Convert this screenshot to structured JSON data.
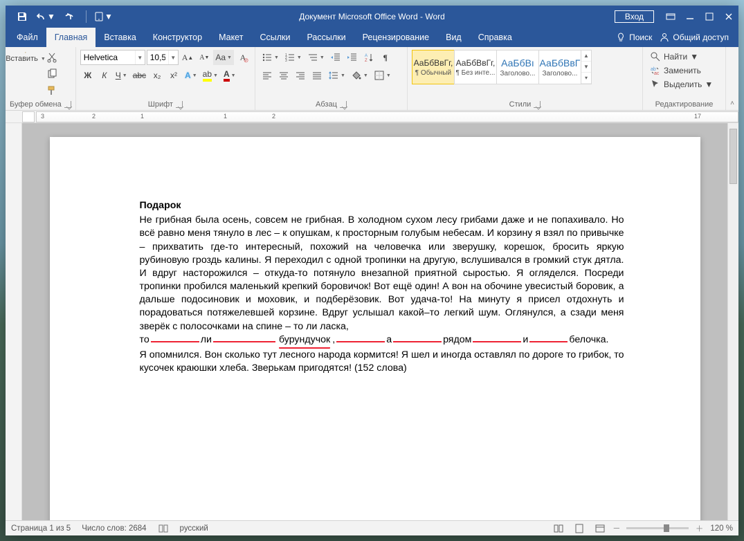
{
  "titlebar": {
    "title": "Документ Microsoft Office Word  -  Word",
    "login": "Вход"
  },
  "tabs": {
    "file": "Файл",
    "items": [
      "Главная",
      "Вставка",
      "Конструктор",
      "Макет",
      "Ссылки",
      "Рассылки",
      "Рецензирование",
      "Вид",
      "Справка"
    ],
    "active_index": 0,
    "tell_me": "Поиск",
    "share": "Общий доступ"
  },
  "ribbon": {
    "clipboard": {
      "paste": "Вставить",
      "label": "Буфер обмена"
    },
    "font": {
      "name": "Helvetica",
      "size": "10,5",
      "bold": "Ж",
      "italic": "К",
      "underline": "Ч",
      "strike": "abc",
      "sub": "x₂",
      "sup": "x²",
      "label": "Шрифт"
    },
    "paragraph": {
      "label": "Абзац"
    },
    "styles": {
      "label": "Стили",
      "items": [
        {
          "sample": "АаБбВвГг,",
          "name": "¶ Обычный"
        },
        {
          "sample": "АаБбВвГг,",
          "name": "¶ Без инте..."
        },
        {
          "sample": "АаБбВı",
          "name": "Заголово..."
        },
        {
          "sample": "АаБбВвГ",
          "name": "Заголово..."
        }
      ]
    },
    "editing": {
      "find": "Найти",
      "replace": "Заменить",
      "select": "Выделить",
      "label": "Редактирование"
    }
  },
  "document": {
    "title": "Подарок",
    "p1": "Не грибная была осень, совсем не грибная. В холодном сухом лесу грибами даже и не попахивало. Но всё равно меня тянуло в лес – к опушкам, к просторным голубым небесам. И корзину я взял по привычке – прихватить где-то интересный, похожий на человечка или зверушку, корешок, бросить яркую рубиновую гроздь калины. Я переходил с одной тропинки на другую, вслушивался в громкий стук дятла. И вдруг насторожился – откуда-то потянуло внезапной приятной сыростью. Я огляделся. Посреди тропинки пробился маленький крепкий боровичок! Вот ещё один! А вон на обочине увесистый боровик, а дальше подосиновик и моховик, и подберёзовик. Вот удача-то! На минуту я присел отдохнуть и порадоваться потяжелевшей корзине. Вдруг услышал какой–то легкий шум. Оглянулся, а сзади меня зверёк с полосочками на спине – то ли ласка,",
    "l_to": "то",
    "l_li": "ли",
    "l_bur": "бурундучок",
    "l_a": "а",
    "l_ryadom": "рядом",
    "l_i": "и",
    "l_bel": "белочка.",
    "p2": "Я опомнился. Вон сколько тут лесного народа кормится! Я шел и иногда оставлял по дороге то грибок, то кусочек краюшки хлеба. Зверькам пригодятся! (152 слова)"
  },
  "status": {
    "page": "Страница 1 из 5",
    "words": "Число слов: 2684",
    "lang": "русский",
    "zoom": "120 %"
  }
}
